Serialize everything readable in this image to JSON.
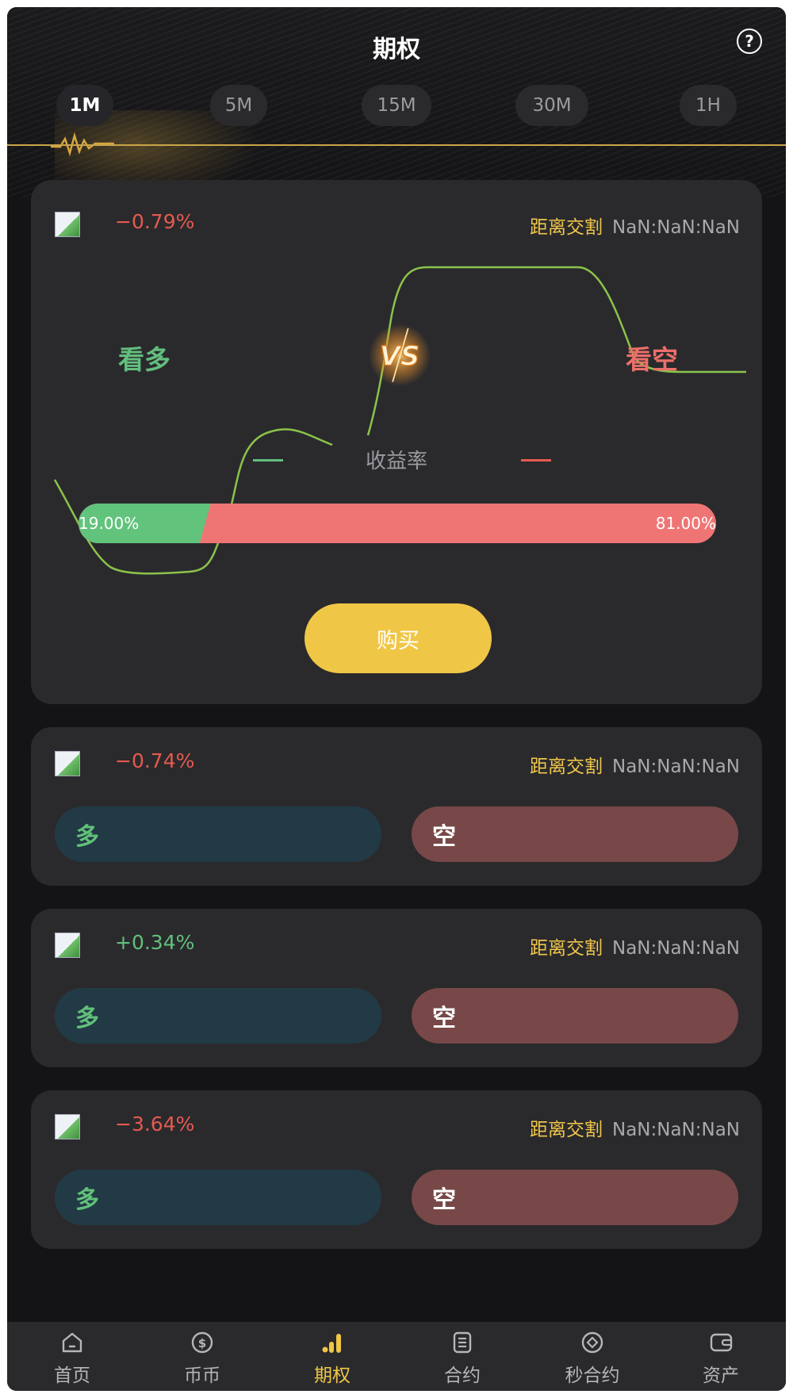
{
  "header": {
    "title": "期权",
    "help_icon": "question-circle-icon"
  },
  "tabs": [
    {
      "label": "1M",
      "active": true
    },
    {
      "label": "5M",
      "active": false
    },
    {
      "label": "15M",
      "active": false
    },
    {
      "label": "30M",
      "active": false
    },
    {
      "label": "1H",
      "active": false
    }
  ],
  "featured": {
    "change": "−0.79%",
    "countdown_label": "距离交割",
    "countdown_value": "NaN:NaN:NaN",
    "long_label": "看多",
    "short_label": "看空",
    "vs_text": "VS",
    "rate_label": "收益率",
    "long_pct_text": "19.00%",
    "short_pct_text": "81.00%",
    "long_fraction": 0.19,
    "buy_label": "购买"
  },
  "cards": [
    {
      "change": "−0.74%",
      "direction": "down",
      "countdown_label": "距离交割",
      "countdown_value": "NaN:NaN:NaN",
      "long": "多",
      "short": "空"
    },
    {
      "change": "+0.34%",
      "direction": "up",
      "countdown_label": "距离交割",
      "countdown_value": "NaN:NaN:NaN",
      "long": "多",
      "short": "空"
    },
    {
      "change": "−3.64%",
      "direction": "down",
      "countdown_label": "距离交割",
      "countdown_value": "NaN:NaN:NaN",
      "long": "多",
      "short": "空"
    }
  ],
  "nav": [
    {
      "label": "首页",
      "icon": "home-icon",
      "active": false
    },
    {
      "label": "币币",
      "icon": "dollar-coin-icon",
      "active": false
    },
    {
      "label": "期权",
      "icon": "bar-chart-icon",
      "active": true
    },
    {
      "label": "合约",
      "icon": "document-icon",
      "active": false
    },
    {
      "label": "秒合约",
      "icon": "diamond-circle-icon",
      "active": false
    },
    {
      "label": "资产",
      "icon": "wallet-icon",
      "active": false
    }
  ],
  "colors": {
    "accent_gold": "#f0c646",
    "long_green": "#62c47c",
    "short_red": "#ef7575",
    "down_red": "#e55a4e",
    "up_green": "#62c07a"
  }
}
